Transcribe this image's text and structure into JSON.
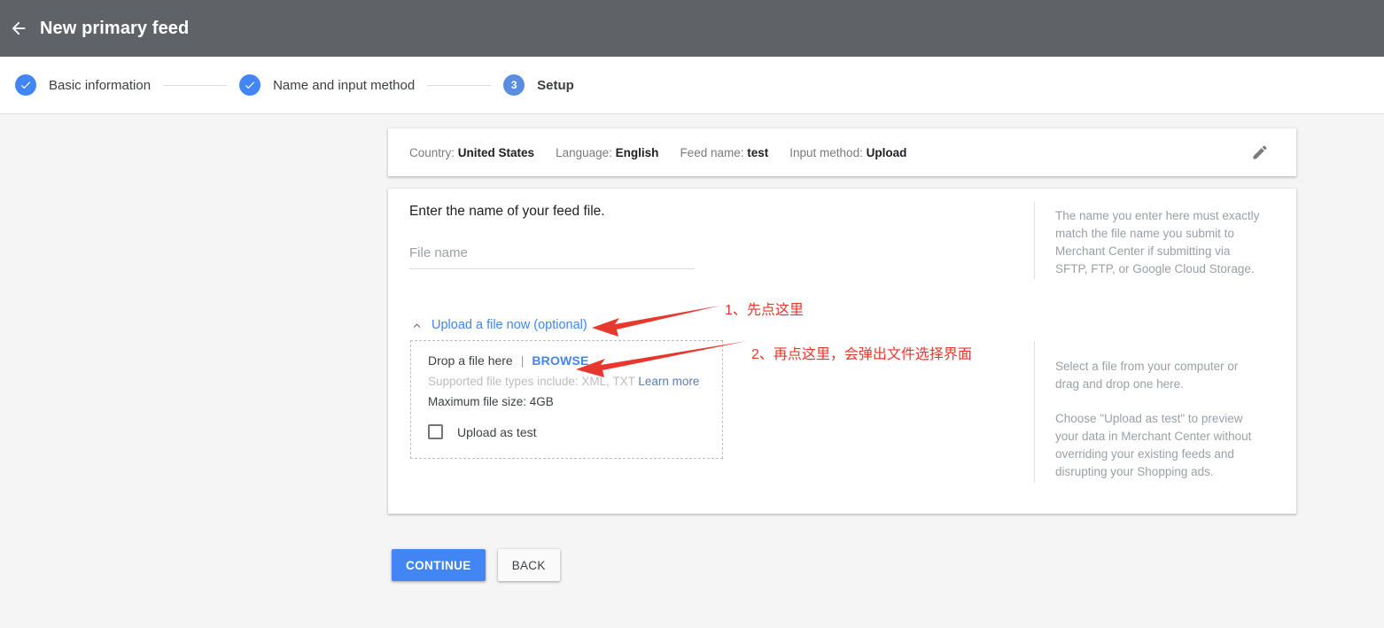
{
  "topbar": {
    "back_icon": "back-arrow-icon",
    "title": "New primary feed"
  },
  "stepper": {
    "steps": [
      {
        "indicator": "✓",
        "label": "Basic information",
        "state": "complete"
      },
      {
        "indicator": "✓",
        "label": "Name and input method",
        "state": "complete"
      },
      {
        "indicator": "3",
        "label": "Setup",
        "state": "current"
      }
    ]
  },
  "summary": {
    "country_label": "Country:",
    "country_value": "United States",
    "language_label": "Language:",
    "language_value": "English",
    "feed_name_label": "Feed name:",
    "feed_name_value": "test",
    "input_method_label": "Input method:",
    "input_method_value": "Upload",
    "edit_icon": "pencil-icon"
  },
  "main": {
    "heading": "Enter the name of your feed file.",
    "file_name_placeholder": "File name",
    "file_name_value": "",
    "upload_toggle_label": "Upload a file now (optional)",
    "upload_toggle_icon": "chevron-up-icon",
    "drop_zone": {
      "drop_text": "Drop a file here",
      "separator": "|",
      "browse_label": "BROWSE",
      "supported_text": "Supported file types include: XML, TXT",
      "learn_more_label": "Learn more",
      "max_size_text": "Maximum file size: 4GB",
      "upload_as_test_label": "Upload as test",
      "upload_as_test_checked": false
    },
    "help": {
      "block_1": "The name you enter here must exactly match the file name you submit to Merchant Center if submitting via SFTP, FTP, or Google Cloud Storage.",
      "block_2": "Select a file from your computer or drag and drop one here.",
      "block_3": "Choose \"Upload as test\" to preview your data in Merchant Center without overriding your existing feeds and disrupting your Shopping ads."
    }
  },
  "buttons": {
    "continue_label": "CONTINUE",
    "back_label": "BACK"
  },
  "annotations": {
    "note_1": "1、先点这里",
    "note_2": "2、再点这里，会弹出文件选择界面",
    "color": "#e8372c"
  },
  "colors": {
    "topbar_bg": "#5f6368",
    "accent_blue": "#4285f4",
    "page_bg": "#f5f5f5",
    "card_bg": "#ffffff",
    "annotation_red": "#e8372c"
  }
}
